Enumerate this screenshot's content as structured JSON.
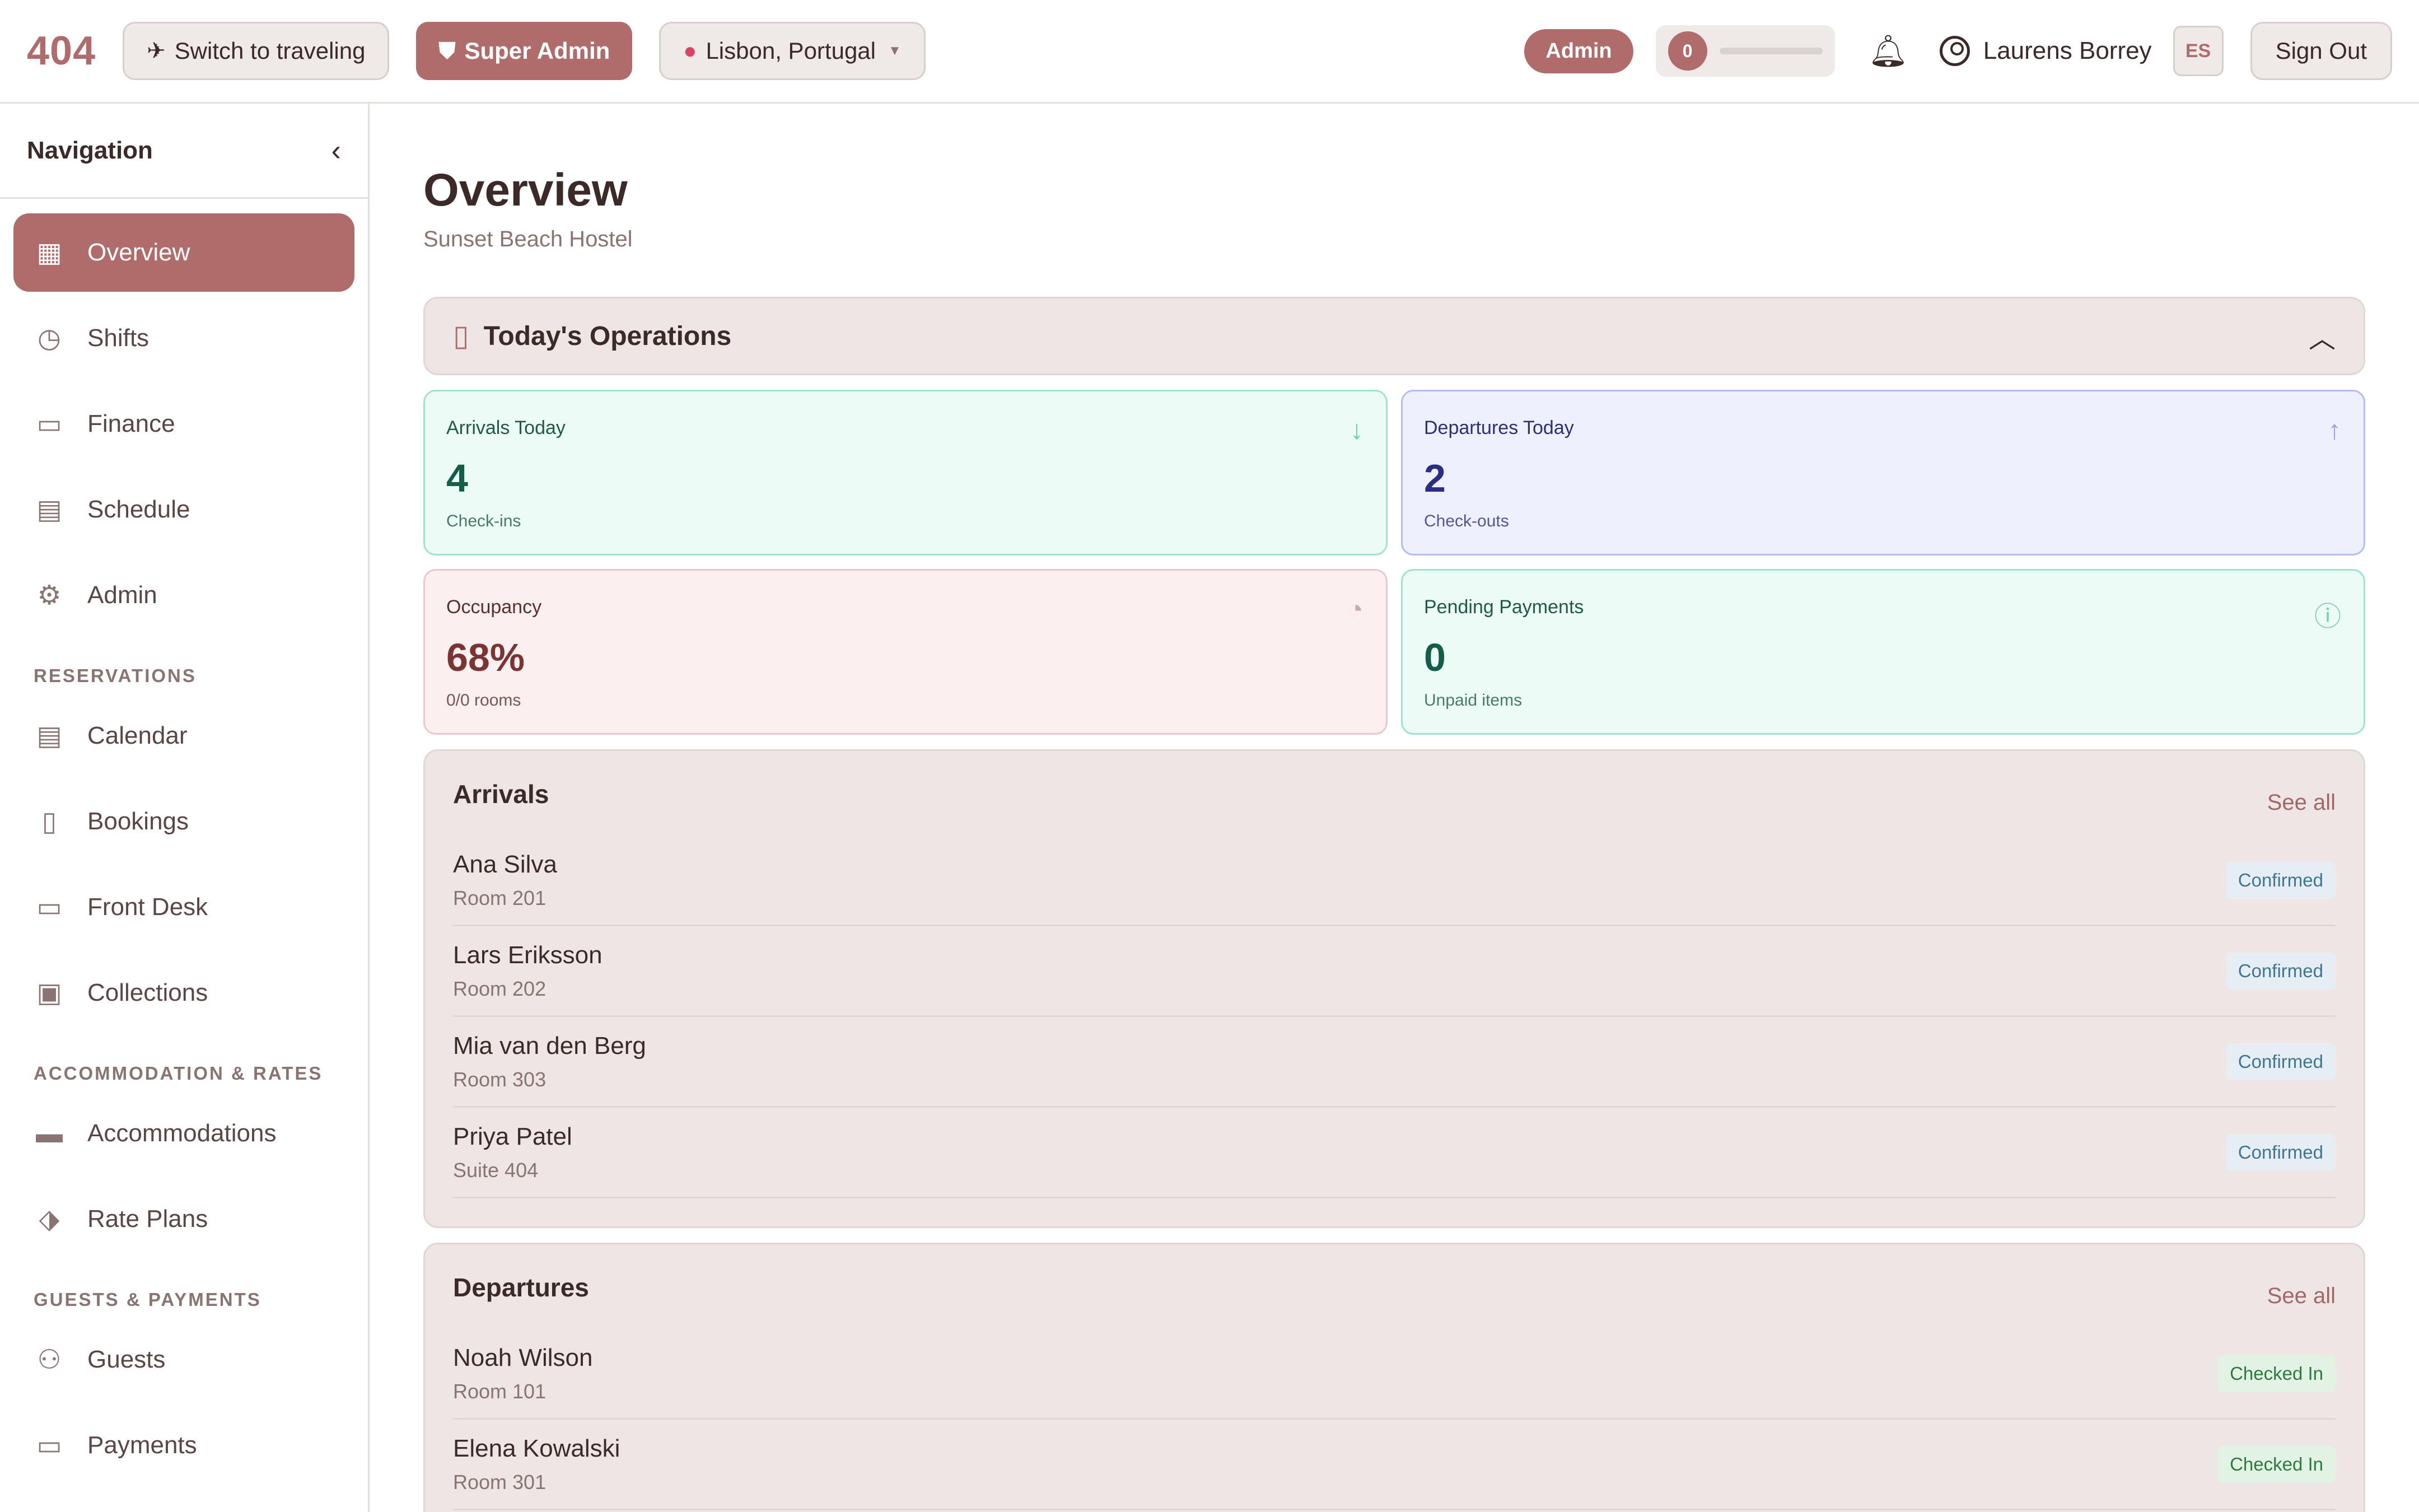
{
  "topbar": {
    "logo": "404",
    "switch_label": "Switch to traveling",
    "super_admin_label": "Super Admin",
    "location": "Lisbon, Portugal",
    "role_badge": "Admin",
    "progress_count": "0",
    "progress_fraction": 0,
    "user_name": "Laurens Borrey",
    "language": "ES",
    "sign_out": "Sign Out"
  },
  "sidebar": {
    "title": "Navigation",
    "main_items": [
      {
        "label": "Overview",
        "icon": "grid-icon",
        "active": true
      },
      {
        "label": "Shifts",
        "icon": "clock-icon"
      },
      {
        "label": "Finance",
        "icon": "wallet-icon"
      },
      {
        "label": "Schedule",
        "icon": "calendar-icon"
      },
      {
        "label": "Admin",
        "icon": "gear-icon"
      }
    ],
    "sections": [
      {
        "title": "RESERVATIONS",
        "items": [
          {
            "label": "Calendar",
            "icon": "calendar-icon"
          },
          {
            "label": "Bookings",
            "icon": "bookmark-icon"
          },
          {
            "label": "Front Desk",
            "icon": "monitor-icon"
          },
          {
            "label": "Collections",
            "icon": "cash-icon"
          }
        ]
      },
      {
        "title": "ACCOMMODATION & RATES",
        "items": [
          {
            "label": "Accommodations",
            "icon": "bed-icon"
          },
          {
            "label": "Rate Plans",
            "icon": "tag-icon"
          }
        ]
      },
      {
        "title": "GUESTS & PAYMENTS",
        "items": [
          {
            "label": "Guests",
            "icon": "users-icon"
          },
          {
            "label": "Payments",
            "icon": "card-icon"
          }
        ]
      }
    ]
  },
  "main": {
    "title": "Overview",
    "subtitle": "Sunset Beach Hostel",
    "operations_title": "Today's Operations",
    "cards": [
      {
        "label": "Arrivals Today",
        "value": "4",
        "sub": "Check-ins"
      },
      {
        "label": "Departures Today",
        "value": "2",
        "sub": "Check-outs"
      },
      {
        "label": "Occupancy",
        "value": "68%",
        "sub": "0/0 rooms"
      },
      {
        "label": "Pending Payments",
        "value": "0",
        "sub": "Unpaid items"
      }
    ],
    "arrivals": {
      "title": "Arrivals",
      "see_all": "See all",
      "rows": [
        {
          "name": "Ana Silva",
          "room": "Room 201",
          "status": "Confirmed"
        },
        {
          "name": "Lars Eriksson",
          "room": "Room 202",
          "status": "Confirmed"
        },
        {
          "name": "Mia van den Berg",
          "room": "Room 303",
          "status": "Confirmed"
        },
        {
          "name": "Priya Patel",
          "room": "Suite 404",
          "status": "Confirmed"
        }
      ]
    },
    "departures": {
      "title": "Departures",
      "see_all": "See all",
      "rows": [
        {
          "name": "Noah Wilson",
          "room": "Room 101",
          "status": "Checked In"
        },
        {
          "name": "Elena Kowalski",
          "room": "Room 301",
          "status": "Checked In"
        }
      ]
    }
  },
  "colors": {
    "accent": "#b06b6b",
    "border": "#e4dedd",
    "panel": "#eee6e4"
  }
}
